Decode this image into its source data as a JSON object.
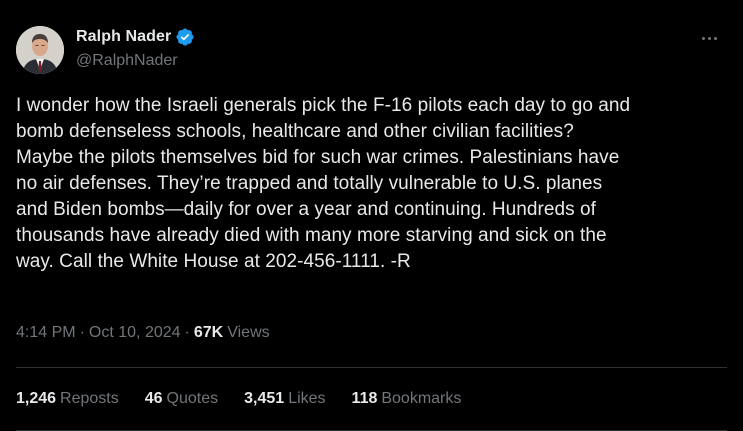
{
  "author": {
    "display_name": "Ralph Nader",
    "handle": "@RalphNader",
    "verified": true
  },
  "tweet": {
    "text": "I wonder how the Israeli generals pick the F-16 pilots each day to go and\nbomb defenseless schools, healthcare and other civilian facilities?\nMaybe the pilots themselves bid for such war crimes. Palestinians have\nno air defenses. They’re trapped and totally vulnerable to U.S. planes\nand Biden bombs—daily for over a year and continuing. Hundreds of\nthousands have already died with many more starving and sick on the\nway. Call the White House at 202-456-1111. -R"
  },
  "meta": {
    "time": "4:14 PM",
    "date": "Oct 10, 2024",
    "separator": "·",
    "views_count": "67K",
    "views_label": "Views"
  },
  "stats": {
    "reposts": {
      "count": "1,246",
      "label": "Reposts"
    },
    "quotes": {
      "count": "46",
      "label": "Quotes"
    },
    "likes": {
      "count": "3,451",
      "label": "Likes"
    },
    "bookmarks": {
      "count": "118",
      "label": "Bookmarks"
    }
  },
  "colors": {
    "background": "#000000",
    "text_primary": "#e7e9ea",
    "text_secondary": "#71767b",
    "verified_badge": "#1d9bf0",
    "divider": "#2f3336"
  },
  "icons": {
    "verified": "verified-badge-icon",
    "more": "more-options-icon"
  }
}
